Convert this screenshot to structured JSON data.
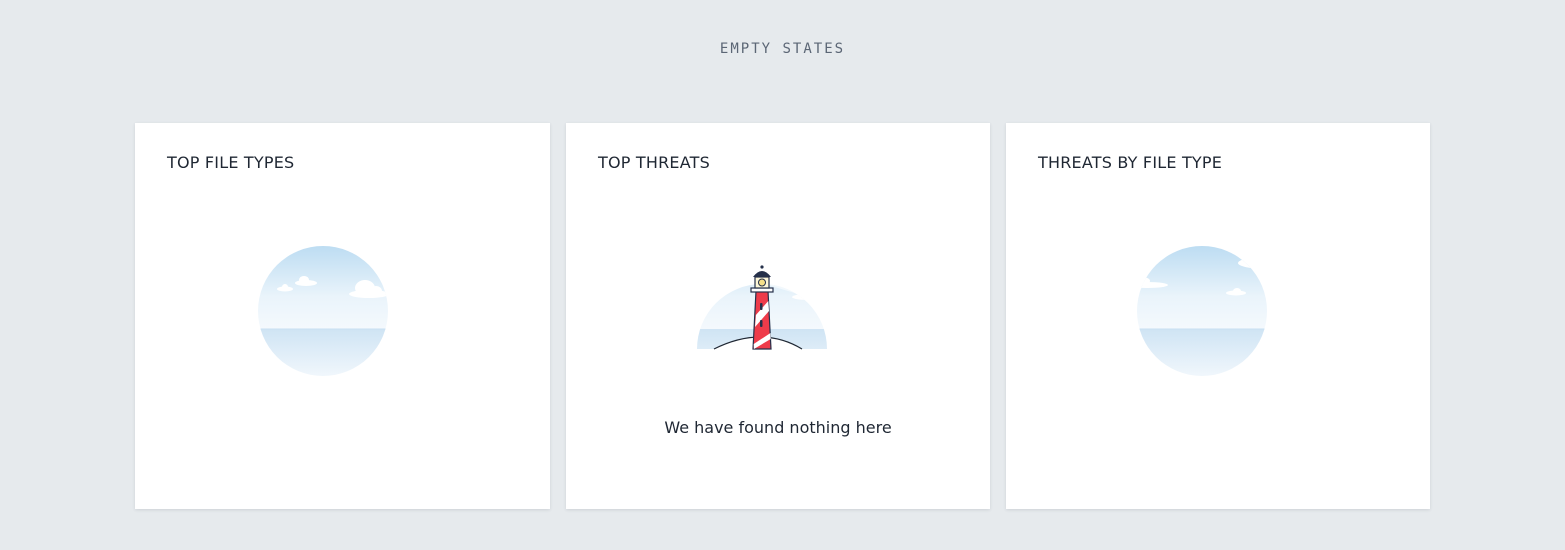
{
  "page": {
    "heading": "EMPTY STATES"
  },
  "cards": [
    {
      "title": "TOP FILE TYPES",
      "illustration": "sea-clouds-illustration"
    },
    {
      "title": "TOP THREATS",
      "illustration": "lighthouse-illustration",
      "message": "We have found nothing here"
    },
    {
      "title": "THREATS BY FILE TYPE",
      "illustration": "sea-horizon-illustration"
    }
  ],
  "colors": {
    "background": "#e6eaed",
    "card": "#ffffff",
    "sky_top": "#bcdcf2",
    "sea": "#d5e8f6",
    "lighthouse_red": "#ee3b4a",
    "lighthouse_dark": "#25304a"
  }
}
